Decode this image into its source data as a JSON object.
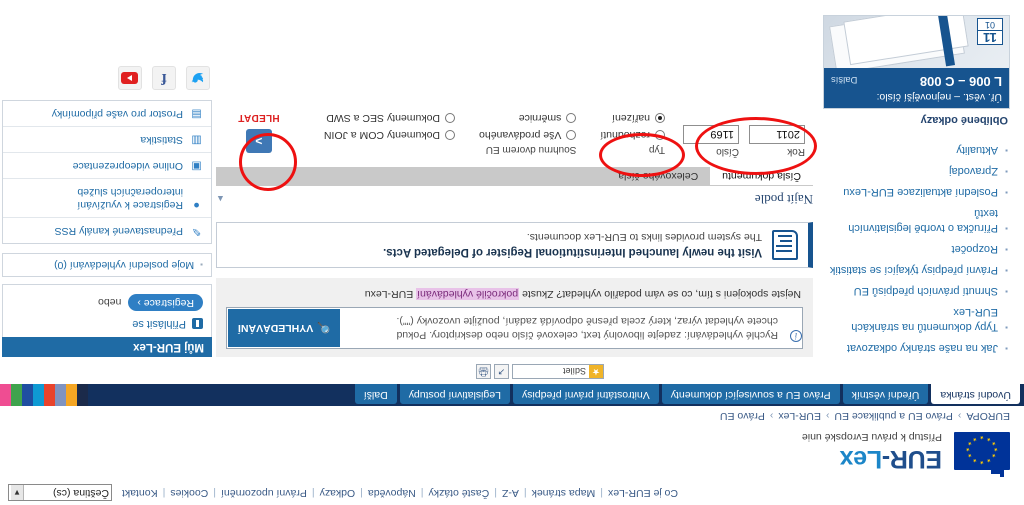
{
  "utility": {
    "links": [
      "Co je EUR-Lex",
      "Mapa stránek",
      "A-Z",
      "Časté otázky",
      "Nápověda",
      "Odkazy",
      "Právní upozornění",
      "Cookies",
      "Kontakt"
    ],
    "language_value": "Čeština (cs)"
  },
  "brand": {
    "title_eur": "EUR-",
    "title_lex": "Lex",
    "subtitle": "Přístup k právu Evropské unie"
  },
  "breadcrumb": {
    "items": [
      "EUROPA",
      "Právo EU a publikace EU",
      "EUR-Lex",
      "Právo EU"
    ],
    "separator": "›"
  },
  "nav": {
    "tabs": [
      {
        "label": "Úvodní stránka",
        "active": true
      },
      {
        "label": "Úřední věstník",
        "active": false
      },
      {
        "label": "Právo EU a související dokumenty",
        "active": false
      },
      {
        "label": "Vnitrostátní právní předpisy",
        "active": false
      },
      {
        "label": "Legislativní postupy",
        "active": false
      },
      {
        "label": "Další",
        "active": false
      }
    ],
    "strip_colors": [
      "#1b2a4a",
      "#f5a623",
      "#7f93c0",
      "#e8432c",
      "#0e9ad3",
      "#1f4ea1",
      "#3fa34d",
      "#ef4d92"
    ]
  },
  "subrow": {
    "bookmark_label": "Sdílet",
    "icon_print": "🖨",
    "icon_share": "↗"
  },
  "left": {
    "links": [
      "Jak na naše stránky odkazovat",
      "Typy dokumentů na stránkách EUR-Lex",
      "Shrnutí právních předpisů EU",
      "Právní předpisy týkající se statistik",
      "Rozpočet",
      "Příručka o tvorbě legislativních textů",
      "Poslední aktualizace EUR-Lexu",
      "Zpravodaj",
      "Aktuality"
    ],
    "favorites_title": "Oblíbené odkazy",
    "card": {
      "line1": "Úř. věst. – nejnovější číslo:",
      "line2": "L 006 – C 008",
      "more": "Dalšís",
      "day": "11",
      "month": "01"
    }
  },
  "search": {
    "hint_line1": "Rychlé vyhledávání: zadejte libovolný text, celexové číslo nebo deskriptory. Pokud",
    "hint_line2": "chcete vyhledat výraz, který zcela přesně odpovídá zadání, použijte uvozovky (\"\").",
    "button_label": "VYHLEDÁVÁNÍ",
    "button_icon": "🔍",
    "info_icon": "i",
    "advanced_prefix": "Nejste spokojeni s tím, co se vám podařilo vyhledat? Zkuste",
    "advanced_link": "pokročilé vyhledávání",
    "advanced_suffix": "EUR-Lexu"
  },
  "banner": {
    "title": "Visit the newly launched Interinstitutional Register of Delegated Acts.",
    "subtitle": "The system provides links to EUR-Lex documents.",
    "icon_name": "document-icon"
  },
  "findby": {
    "heading": "Najít podle",
    "collapse_icon": "▲",
    "tabs": [
      {
        "label": "Čísla dokumentu",
        "active": true
      },
      {
        "label": "Celexového čísla",
        "active": false
      }
    ],
    "fields": [
      {
        "label": "Rok",
        "value": "2011"
      },
      {
        "label": "Číslo",
        "value": "1169"
      }
    ],
    "type_label": "Typ",
    "type_options": [
      {
        "label": "nařízení",
        "selected": true
      },
      {
        "label": "rozhodnutí",
        "selected": false
      }
    ],
    "col2_label": "Souhrnu dvorem EU",
    "col2_options": [
      {
        "label": "Vše prodávaného",
        "selected": false
      },
      {
        "label": "směrnice",
        "selected": false
      }
    ],
    "col3_options": [
      {
        "label": "Dokumenty COM a JOIN",
        "selected": false
      },
      {
        "label": "Dokumenty SEC a SWD",
        "selected": false
      }
    ],
    "go_icon": ">",
    "go_label": "HLEDAT"
  },
  "right": {
    "my_header": "Můj EUR-Lex",
    "login_label": "Přihlásit se",
    "register_label": "Registrace ›",
    "register_or": "nebo",
    "recent_label": "Moje poslední vyhledávání (0)",
    "links": [
      {
        "label": "Přednastavené kanály RSS",
        "icon": "rss-icon",
        "glyph": "✎"
      },
      {
        "label": "Registrace k využívání interoperačních služeb",
        "icon": "users-icon",
        "glyph": "●"
      },
      {
        "label": "Online videoprezentace",
        "icon": "video-icon",
        "glyph": "▣"
      },
      {
        "label": "Statistika",
        "icon": "chart-icon",
        "glyph": "▥"
      },
      {
        "label": "Prostor pro vaše připomínky",
        "icon": "feedback-icon",
        "glyph": "▤"
      }
    ],
    "social": [
      {
        "name": "twitter-icon",
        "glyph": "🐦"
      },
      {
        "name": "facebook-icon",
        "glyph": "f"
      },
      {
        "name": "youtube-icon",
        "glyph": ""
      }
    ]
  },
  "colors": {
    "brand_blue": "#1f4e8c",
    "accent_blue": "#1c86c8",
    "nav_dark": "#12305e",
    "annotation_red": "#e11"
  }
}
